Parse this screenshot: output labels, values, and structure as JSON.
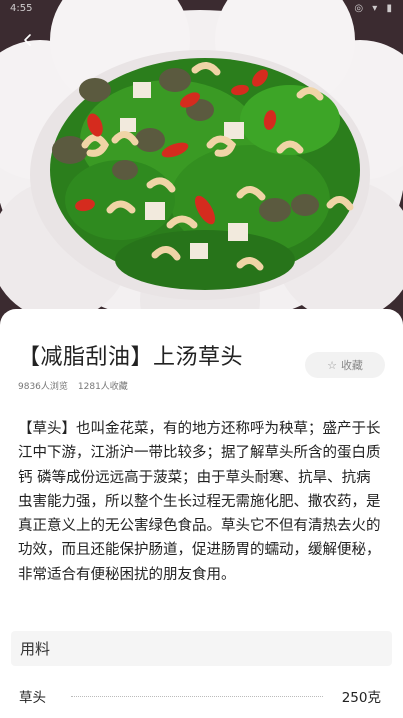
{
  "status_bar": {
    "time": "4:55",
    "icons": "◎ ▾ ▮"
  },
  "recipe": {
    "title": "【减脂刮油】上汤草头",
    "views": "9836人浏览",
    "favorites": "1281人收藏",
    "collect_label": "收藏",
    "description": "【草头】也叫金花菜，有的地方还称呼为秧草；盛产于长江中下游，江浙沪一带比较多；据了解草头所含的蛋白质 钙 磷等成份远远高于菠菜；由于草头耐寒、抗旱、抗病虫害能力强，所以整个生长过程无需施化肥、撒农药，是真正意义上的无公害绿色食品。草头它不但有清热去火的功效，而且还能保护肠道，促进肠胃的蠕动，缓解便秘，非常适合有便秘困扰的朋友食用。"
  },
  "ingredients": {
    "header": "用料",
    "items": [
      {
        "name": "草头",
        "amount": "250克"
      }
    ]
  },
  "icons": {
    "back": "chevron-left-icon",
    "collect": "star-outline-icon"
  },
  "colors": {
    "plate": "#f4f1f2",
    "greens": "#2f8a1f",
    "goji": "#d42a1e",
    "shrimp": "#f3d9b0"
  }
}
